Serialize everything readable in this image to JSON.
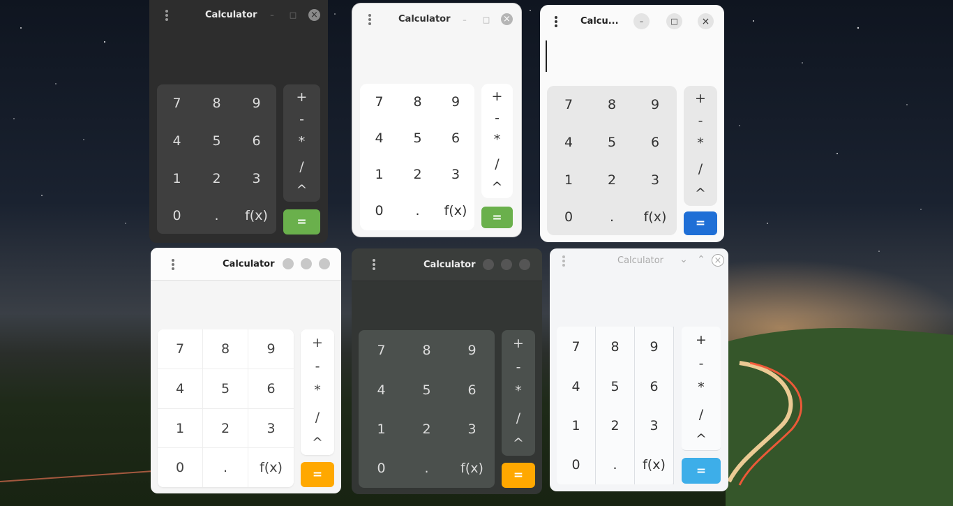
{
  "desktop": {
    "wallpaper": "night-sky-road"
  },
  "windows": [
    {
      "title": "Calculator",
      "theme": "dark-grey",
      "accent": "#6ab04c",
      "digits": [
        "7",
        "8",
        "9",
        "4",
        "5",
        "6",
        "1",
        "2",
        "3",
        "0",
        ".",
        "f(x)"
      ],
      "ops": [
        "+",
        "-",
        "*",
        "/",
        "^"
      ],
      "equals": "="
    },
    {
      "title": "Calculator",
      "theme": "light-rounded",
      "accent": "#6ab04c",
      "digits": [
        "7",
        "8",
        "9",
        "4",
        "5",
        "6",
        "1",
        "2",
        "3",
        "0",
        ".",
        "f(x)"
      ],
      "ops": [
        "+",
        "-",
        "*",
        "/",
        "^"
      ],
      "equals": "="
    },
    {
      "title": "Calcu...",
      "theme": "light-blue",
      "accent": "#1f6fd6",
      "digits": [
        "7",
        "8",
        "9",
        "4",
        "5",
        "6",
        "1",
        "2",
        "3",
        "0",
        ".",
        "f(x)"
      ],
      "ops": [
        "+",
        "-",
        "*",
        "/",
        "^"
      ],
      "equals": "="
    },
    {
      "title": "Calculator",
      "theme": "light-orange",
      "accent": "#ffa800",
      "digits": [
        "7",
        "8",
        "9",
        "4",
        "5",
        "6",
        "1",
        "2",
        "3",
        "0",
        ".",
        "f(x)"
      ],
      "ops": [
        "+",
        "-",
        "*",
        "/",
        "^"
      ],
      "equals": "="
    },
    {
      "title": "Calculator",
      "theme": "dark-slate",
      "accent": "#ffa800",
      "digits": [
        "7",
        "8",
        "9",
        "4",
        "5",
        "6",
        "1",
        "2",
        "3",
        "0",
        ".",
        "f(x)"
      ],
      "ops": [
        "+",
        "-",
        "*",
        "/",
        "^"
      ],
      "equals": "="
    },
    {
      "title": "Calculator",
      "theme": "light-skyblue",
      "accent": "#3daee9",
      "digits": [
        "7",
        "8",
        "9",
        "4",
        "5",
        "6",
        "1",
        "2",
        "3",
        "0",
        ".",
        "f(x)"
      ],
      "ops": [
        "+",
        "-",
        "*",
        "/",
        "^"
      ],
      "equals": "="
    }
  ],
  "window_controls": {
    "minimize": "–",
    "maximize": "□",
    "close": "×",
    "collapse": "⌄",
    "expand": "⌃"
  }
}
